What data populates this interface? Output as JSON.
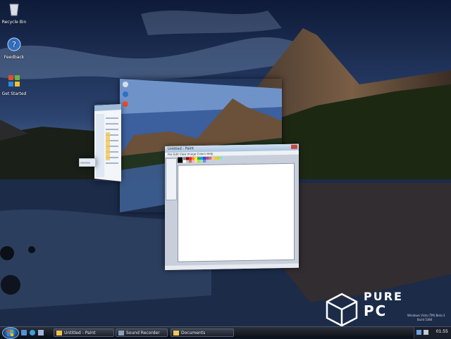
{
  "desktop": {
    "icons": [
      {
        "label": "Recycle Bin",
        "icon": "recycle-bin-icon"
      },
      {
        "label": "Feedback",
        "icon": "feedback-icon"
      },
      {
        "label": "Get Started",
        "icon": "windows-flag-icon"
      }
    ]
  },
  "paint": {
    "title": "Untitled - Paint",
    "menu": "File  Edit  View  Image  Colors  Help"
  },
  "taskbar": {
    "items": [
      {
        "label": "Untitled - Paint"
      },
      {
        "label": "Sound Recorder"
      },
      {
        "label": "Documents"
      }
    ],
    "clock": "01:55"
  },
  "watermark": {
    "brand_top": "PURE",
    "brand_bottom": "PC",
    "build_line1": "Windows Vista (TM) Beta 2",
    "build_line2": "Build 5384"
  },
  "colors": {
    "sky": "#2b4673",
    "water": "#1c2d4f",
    "mountain": "#3a2f27",
    "forest": "#1f2a17",
    "taskbar": "#12161e"
  }
}
